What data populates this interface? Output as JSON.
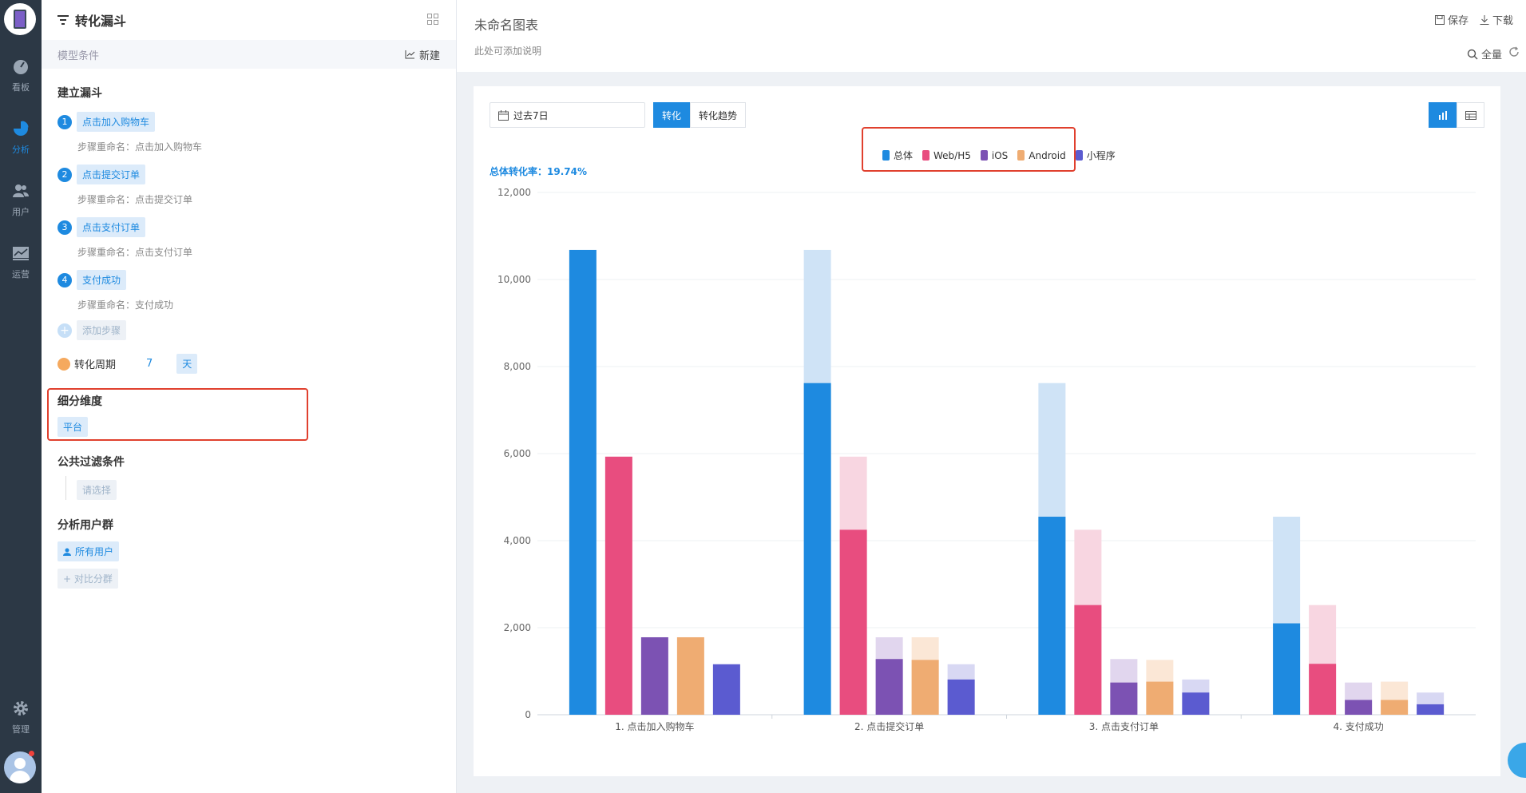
{
  "nav": {
    "items": [
      {
        "label": "看板",
        "icon": "dashboard-icon"
      },
      {
        "label": "分析",
        "icon": "pie-chart-icon"
      },
      {
        "label": "用户",
        "icon": "users-icon"
      },
      {
        "label": "运营",
        "icon": "trend-icon"
      },
      {
        "label": "管理",
        "icon": "gear-icon"
      }
    ]
  },
  "panel": {
    "title": "转化漏斗",
    "condition_label": "模型条件",
    "new_label": "新建",
    "build_title": "建立漏斗",
    "steps": [
      {
        "num": "1",
        "event": "点击加入购物车",
        "rename": "步骤重命名：点击加入购物车"
      },
      {
        "num": "2",
        "event": "点击提交订单",
        "rename": "步骤重命名：点击提交订单"
      },
      {
        "num": "3",
        "event": "点击支付订单",
        "rename": "步骤重命名：点击支付订单"
      },
      {
        "num": "4",
        "event": "支付成功",
        "rename": "步骤重命名：支付成功"
      }
    ],
    "add_step": "添加步骤",
    "period_label": "转化周期",
    "period_value": "7",
    "period_unit": "天",
    "breakdown_title": "细分维度",
    "breakdown_value": "平台",
    "filter_title": "公共过滤条件",
    "filter_placeholder": "请选择",
    "group_title": "分析用户群",
    "group_value": "所有用户",
    "compare_label": "+ 对比分群"
  },
  "header": {
    "chart_name": "未命名图表",
    "chart_desc": "此处可添加说明",
    "save": "保存",
    "download": "下载",
    "quanliang": "全量"
  },
  "toolbar": {
    "date_range": "过去7日",
    "tab_convert": "转化",
    "tab_trend": "转化趋势"
  },
  "summary": {
    "rate_label": "总体转化率：19.74%"
  },
  "colors": {
    "accent": "#1e8ae0",
    "series": [
      "#1e8ae0",
      "#e84d7f",
      "#7c52b3",
      "#efac72",
      "#5b5bd0"
    ],
    "series_light": [
      "#cfe3f6",
      "#f8d6e1",
      "#e1d6ee",
      "#fbe7d6",
      "#d8d8f3"
    ]
  },
  "chart_data": {
    "type": "bar",
    "categories": [
      "1. 点击加入购物车",
      "2. 点击提交订单",
      "3. 点击支付订单",
      "4. 支付成功"
    ],
    "series": [
      {
        "name": "总体",
        "values": [
          10680,
          7620,
          4550,
          2100
        ]
      },
      {
        "name": "Web/H5",
        "values": [
          5930,
          4250,
          2520,
          1170
        ]
      },
      {
        "name": "iOS",
        "values": [
          1780,
          1280,
          740,
          340
        ]
      },
      {
        "name": "Android",
        "values": [
          1780,
          1260,
          760,
          340
        ]
      },
      {
        "name": "小程序",
        "values": [
          1160,
          810,
          510,
          240
        ]
      }
    ],
    "ylim": [
      0,
      12000
    ],
    "yticks": [
      "0",
      "2,000",
      "4,000",
      "6,000",
      "8,000",
      "10,000",
      "12,000"
    ],
    "legend_position": "top-center",
    "grid": true
  }
}
